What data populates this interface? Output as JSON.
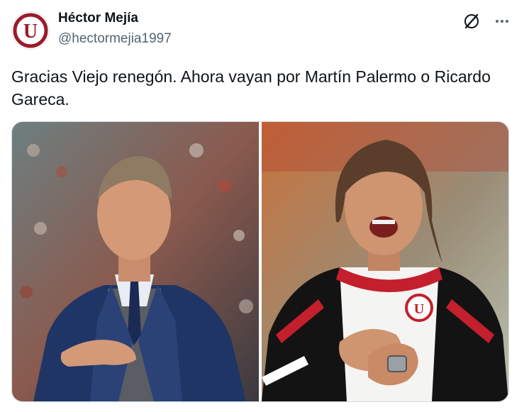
{
  "author": {
    "display_name": "Héctor Mejía",
    "handle": "@hectormejia1997",
    "avatar_icon": "universitario-crest-icon",
    "avatar_letter": "U"
  },
  "header_actions": {
    "grok_icon": "grok-icon",
    "more_icon": "more-options-icon"
  },
  "tweet": {
    "text": "Gracias Viejo renegón. Ahora vayan por Martín Palermo o Ricardo Gareca."
  },
  "media": {
    "photos": [
      {
        "icon": "photo-man-in-blue-suit"
      },
      {
        "icon": "photo-man-shouting-in-u-jacket",
        "jacket_letter": "U"
      }
    ]
  },
  "colors": {
    "brand_red": "#9c1b2a",
    "text_primary": "#0f1419",
    "text_secondary": "#536471",
    "border": "#cfd9de"
  }
}
